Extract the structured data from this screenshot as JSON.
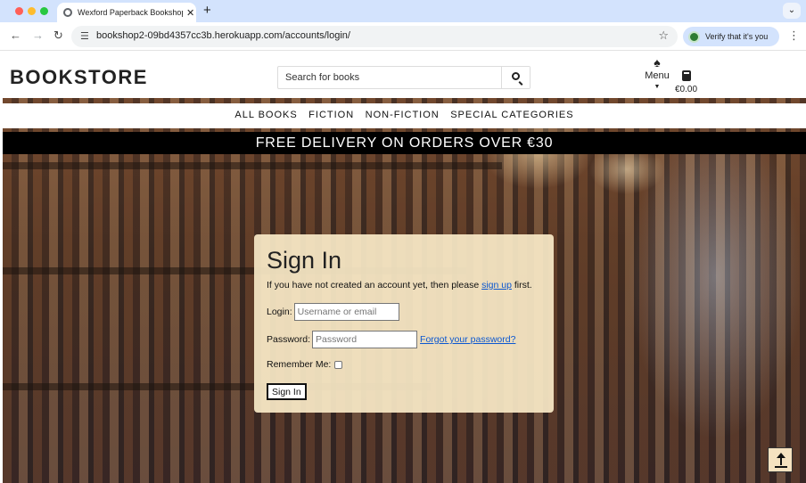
{
  "browser": {
    "tab_title": "Wexford Paperback Bookshop",
    "tab_close": "✕",
    "new_tab": "+",
    "tab_menu": "⌄",
    "url": "bookshop2-09bd4357cc3b.herokuapp.com/accounts/login/",
    "verify_label": "Verify that it's you",
    "icons": {
      "back": "arrow-left-icon",
      "forward": "arrow-right-icon",
      "reload": "reload-icon",
      "site_info": "tune-icon",
      "bookmark": "star-icon",
      "menu": "kebab-icon"
    }
  },
  "header": {
    "brand": "BOOKSTORE",
    "search_placeholder": "Search for books",
    "menu_label": "Menu",
    "bag_total": "€0.00"
  },
  "nav": {
    "items": [
      {
        "label": "ALL BOOKS"
      },
      {
        "label": "FICTION"
      },
      {
        "label": "NON-FICTION"
      },
      {
        "label": "SPECIAL CATEGORIES"
      }
    ]
  },
  "banner": {
    "text": "FREE DELIVERY ON ORDERS OVER €30"
  },
  "signin": {
    "title": "Sign In",
    "intro_before": "If you have not created an account yet, then please ",
    "signup_link": "sign up",
    "intro_after": " first.",
    "login_label": "Login:",
    "login_placeholder": "Username or email",
    "password_label": "Password:",
    "password_placeholder": "Password",
    "forgot_link": "Forgot your password?",
    "remember_label": "Remember Me:",
    "remember_checked": false,
    "submit_label": "Sign In"
  },
  "colors": {
    "card_background": "#faeac8",
    "banner_background": "#000000",
    "link": "#0b57d0",
    "chrome_tabbar": "#d3e3fd"
  }
}
